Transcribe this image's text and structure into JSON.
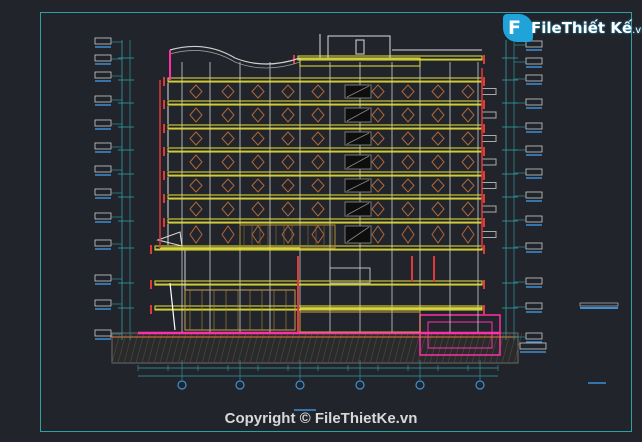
{
  "watermark": {
    "logo_initial": "F",
    "logo_text": "File",
    "logo_text_2": "Thiết Kế",
    "logo_suffix": ".vn",
    "copyright": "Copyright © FileThietKe.vn"
  },
  "drawing": {
    "background": "#21252b",
    "frame_color": "#2fa0a6",
    "slab_color": "#e8e23a",
    "wall_color": "#ffffff",
    "beam_color": "#e03a3a",
    "ground_color": "#ff2fa8",
    "hatch_color": "#b0683a",
    "dim_color": "#2fa0a6",
    "grid_bubble_color": "#3a8fd6",
    "floors": 11,
    "grid_axes": 6
  }
}
